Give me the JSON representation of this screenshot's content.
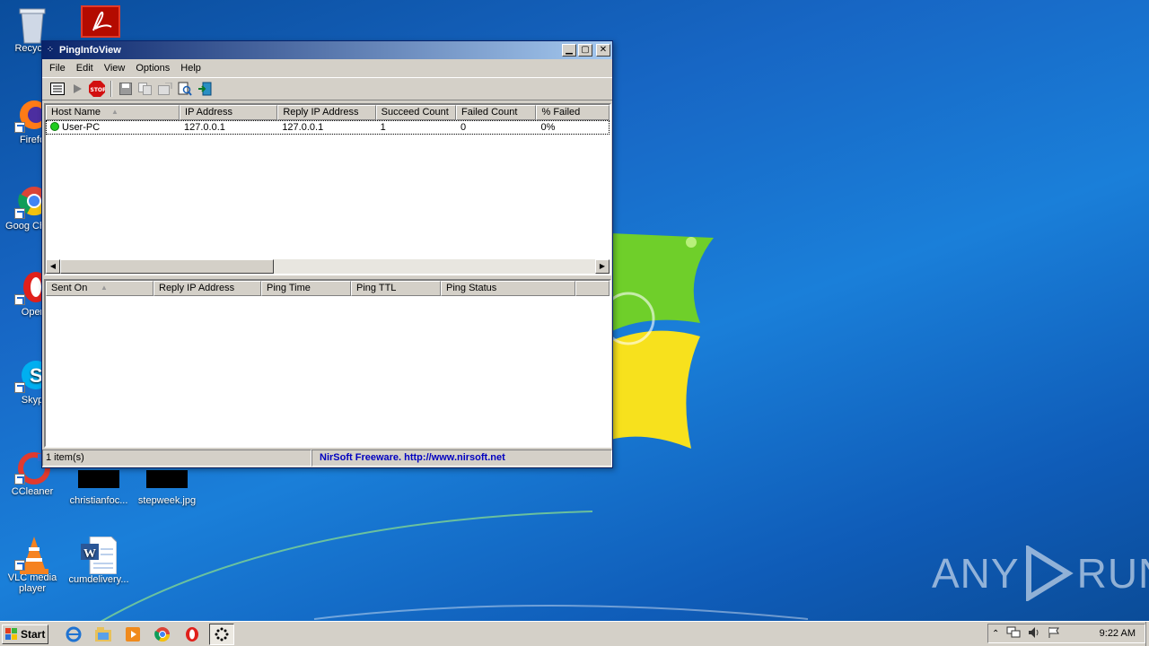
{
  "window": {
    "title": "PingInfoView",
    "menu": [
      "File",
      "Edit",
      "View",
      "Options",
      "Help"
    ],
    "top_list": {
      "columns": [
        "Host Name",
        "IP Address",
        "Reply IP Address",
        "Succeed Count",
        "Failed Count",
        "% Failed"
      ],
      "rows": [
        {
          "host": "User-PC",
          "ip": "127.0.0.1",
          "reply_ip": "127.0.0.1",
          "succeed": "1",
          "failed": "0",
          "pct_failed": "0%"
        }
      ]
    },
    "bottom_list": {
      "columns": [
        "Sent On",
        "Reply IP Address",
        "Ping Time",
        "Ping TTL",
        "Ping Status"
      ]
    },
    "status": {
      "items": "1 item(s)",
      "credit": "NirSoft Freeware.  http://www.nirsoft.net"
    }
  },
  "desktop": {
    "icons": [
      {
        "label": "Recycle",
        "icon": "recycle-bin-icon"
      },
      {
        "label": "Firefo",
        "icon": "firefox-icon"
      },
      {
        "label": "Goog Chron",
        "icon": "chrome-icon"
      },
      {
        "label": "Oper",
        "icon": "opera-icon"
      },
      {
        "label": "Skyp",
        "icon": "skype-icon"
      },
      {
        "label": "CCleaner",
        "icon": "ccleaner-icon"
      },
      {
        "label": "christianfoc...",
        "icon": "image-thumbnail-icon"
      },
      {
        "label": "stepweek.jpg",
        "icon": "image-thumbnail-icon"
      },
      {
        "label": "VLC media player",
        "icon": "vlc-icon"
      },
      {
        "label": "cumdelivery...",
        "icon": "word-document-icon"
      }
    ]
  },
  "taskbar": {
    "start_label": "Start",
    "clock": "9:22 AM"
  },
  "watermark": {
    "left": "ANY",
    "right": "RUN"
  },
  "colors": {
    "titlebar": "#0a246a",
    "link": "#0000c0",
    "status_ok": "#1fcc1f"
  }
}
